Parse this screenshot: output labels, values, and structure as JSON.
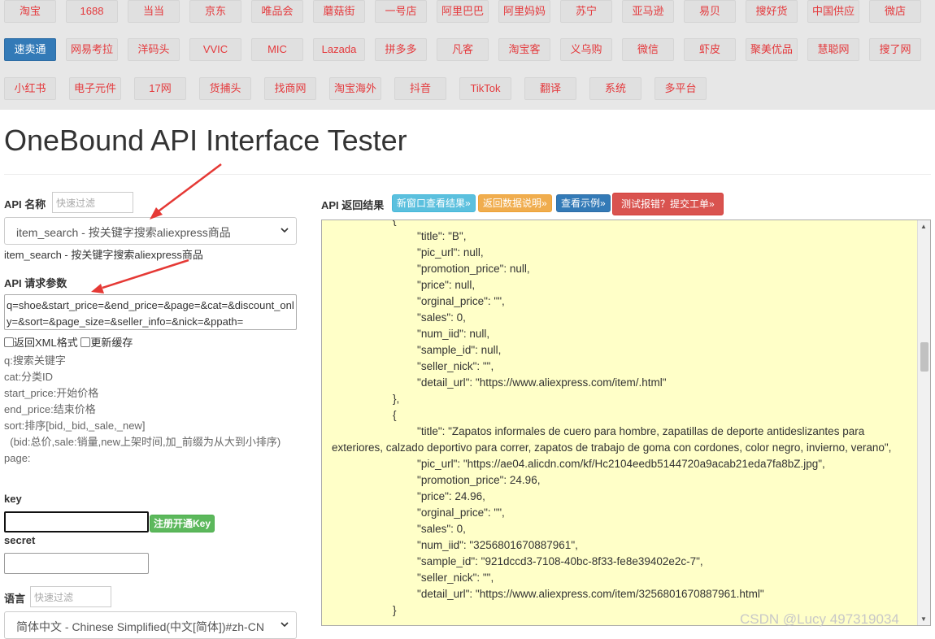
{
  "nav": {
    "row1": [
      "淘宝",
      "1688",
      "当当",
      "京东",
      "唯品会",
      "蘑菇街",
      "一号店",
      "阿里巴巴",
      "阿里妈妈",
      "苏宁",
      "亚马逊",
      "易贝",
      "搜好货",
      "中国供应",
      "微店"
    ],
    "row2": [
      "速卖通",
      "网易考拉",
      "洋码头",
      "VVIC",
      "MIC",
      "Lazada",
      "拼多多",
      "凡客",
      "淘宝客",
      "义乌购",
      "微信",
      "虾皮",
      "聚美优品",
      "慧聪网",
      "搜了网"
    ],
    "row3": [
      "小红书",
      "电子元件",
      "17网",
      "货捕头",
      "找商网",
      "淘宝海外",
      "抖音",
      "TikTok",
      "翻译",
      "系统",
      "多平台"
    ],
    "active": "速卖通"
  },
  "page_title": "OneBound API Interface Tester",
  "left": {
    "api_name_label": "API 名称",
    "filter_placeholder": "快速过滤",
    "api_select_value": "item_search - 按关键字搜索aliexpress商品",
    "api_desc": "item_search - 按关键字搜索aliexpress商品",
    "params_label": "API 请求参数",
    "params_value": "q=shoe&start_price=&end_price=&page=&cat=&discount_only=&sort=&page_size=&seller_info=&nick=&ppath=",
    "xml_label": "返回XML格式",
    "cache_label": "更新缓存",
    "hints": [
      "q:搜索关键字",
      "cat:分类ID",
      "start_price:开始价格",
      "end_price:结束价格",
      "sort:排序[bid,_bid,_sale,_new]",
      "  (bid:总价,sale:销量,new上架时间,加_前缀为从大到小排序)",
      "page:"
    ],
    "key_label": "key",
    "register_btn": "注册开通Key",
    "secret_label": "secret",
    "lang_label": "语言",
    "lang_filter_placeholder": "快速过滤",
    "lang_value": "简体中文 - Chinese Simplified(中文[简体])#zh-CN"
  },
  "right": {
    "result_label": "API 返回结果",
    "btn_new_window": "新窗口查看结果»",
    "btn_data_desc": "返回数据说明»",
    "btn_example": "查看示例»",
    "btn_report": "测试报错？提交工单»",
    "colors": {
      "new_window": "#5bc0de",
      "data_desc": "#f0ad4e",
      "example": "#337ab7",
      "report": "#d9534f"
    },
    "json_lines": [
      "                    {",
      "                            \"title\": \"B\",",
      "                            \"pic_url\": null,",
      "                            \"promotion_price\": null,",
      "                            \"price\": null,",
      "                            \"orginal_price\": \"\",",
      "                            \"sales\": 0,",
      "                            \"num_iid\": null,",
      "                            \"sample_id\": null,",
      "                            \"seller_nick\": \"\",",
      "                            \"detail_url\": \"https://www.aliexpress.com/item/.html\"",
      "                    },",
      "                    {",
      "                            \"title\": \"Zapatos informales de cuero para hombre, zapatillas de deporte antideslizantes para exteriores, calzado deportivo para correr, zapatos de trabajo de goma con cordones, color negro, invierno, verano\",",
      "                            \"pic_url\": \"https://ae04.alicdn.com/kf/Hc2104eedb5144720a9acab21eda7fa8bZ.jpg\",",
      "                            \"promotion_price\": 24.96,",
      "                            \"price\": 24.96,",
      "                            \"orginal_price\": \"\",",
      "                            \"sales\": 0,",
      "                            \"num_iid\": \"3256801670887961\",",
      "                            \"sample_id\": \"921dccd3-7108-40bc-8f33-fe8e39402e2c-7\",",
      "                            \"seller_nick\": \"\",",
      "                            \"detail_url\": \"https://www.aliexpress.com/item/3256801670887961.html\"",
      "                    }"
    ]
  },
  "watermark": "CSDN @Lucy 497319034"
}
